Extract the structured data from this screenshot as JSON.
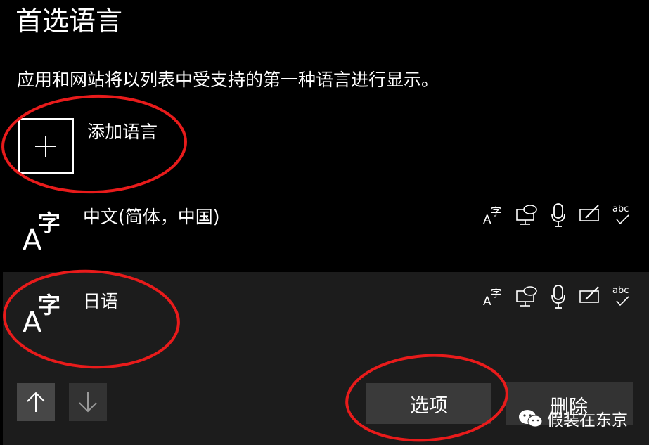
{
  "page": {
    "title": "首选语言",
    "description": "应用和网站将以列表中受支持的第一种语言进行显示。"
  },
  "add_language": {
    "label": "添加语言",
    "icon": "plus-icon"
  },
  "languages": [
    {
      "name": "中文(简体，中国)",
      "icon_letter": "A",
      "icon_char": "字"
    },
    {
      "name": "日语",
      "icon_letter": "A",
      "icon_char": "字"
    }
  ],
  "feature_icons": [
    "display-language-icon",
    "speech-display-icon",
    "microphone-icon",
    "handwriting-icon",
    "spell-check-icon"
  ],
  "feature_icon_text": "abc",
  "buttons": {
    "options": "选项",
    "remove": "删除"
  },
  "watermark": {
    "text": "假装在东京",
    "icon": "wechat-icon"
  },
  "annotation_color": "#e81b1b"
}
